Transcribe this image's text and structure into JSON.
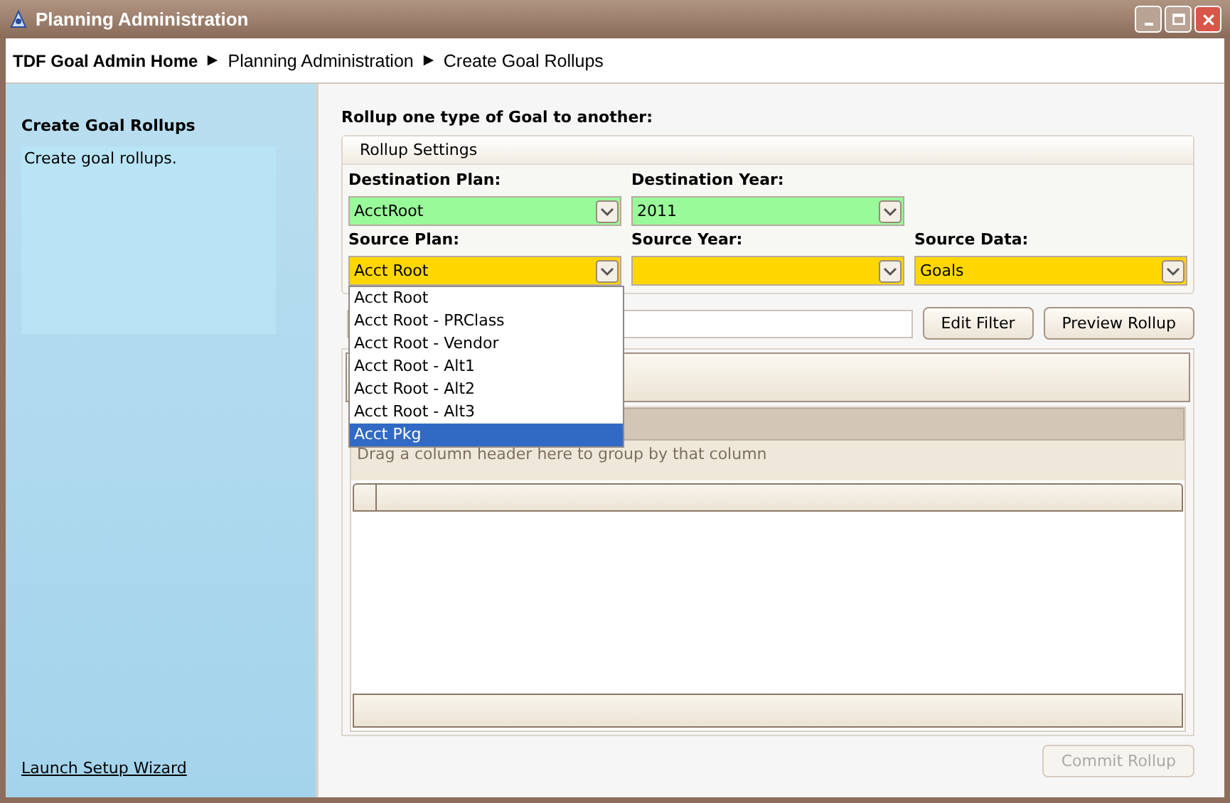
{
  "window": {
    "title": "Planning Administration",
    "controls": [
      {
        "kind": "minimize"
      },
      {
        "kind": "maximize"
      },
      {
        "kind": "close"
      }
    ]
  },
  "breadcrumb": [
    {
      "label": "TDF Goal Admin Home",
      "kind": "root"
    },
    {
      "label": "Planning Administration",
      "kind": "crumb"
    },
    {
      "label": "Create Goal Rollups",
      "kind": "crumb"
    }
  ],
  "sidebar": {
    "title": "Create Goal Rollups",
    "description": "Create goal rollups.",
    "link": "Launch Setup Wizard"
  },
  "main": {
    "heading": "Rollup one type of Goal to another:",
    "settings": {
      "title": "Rollup Settings",
      "rows": [
        [
          {
            "label": "Destination Plan:",
            "value": "AcctRoot",
            "color": "#99fa99"
          },
          {
            "label": "Destination Year:",
            "value": "2011",
            "color": "#99fa99"
          }
        ],
        [
          {
            "label": "Source Plan:",
            "value": "Acct Root",
            "color": "#ffd700",
            "expanded": true
          },
          {
            "label": "Source Year:",
            "color": "#ffd700",
            "expanded": false
          },
          {
            "label": "Source Data:",
            "value": "Goals",
            "color": "#ffd700",
            "expanded": false
          }
        ]
      ],
      "options": [
        {
          "label": "Acct Root",
          "selected": false
        },
        {
          "label": "Acct Root - PRClass",
          "selected": false
        },
        {
          "label": "Acct Root - Vendor",
          "selected": false
        },
        {
          "label": "Acct Root - Alt1",
          "selected": false
        },
        {
          "label": "Acct Root - Alt2",
          "selected": false
        },
        {
          "label": "Acct Root - Alt3",
          "selected": false
        },
        {
          "label": "Acct Pkg",
          "selected": true
        }
      ]
    },
    "filter_buttons": [
      {
        "label": "Edit Filter",
        "disabled": false
      },
      {
        "label": "Preview Rollup",
        "disabled": false
      }
    ],
    "grid": {
      "group_hint": "Drag a column header here to group by that column"
    },
    "commit": {
      "label": "Commit Rollup",
      "disabled": true
    }
  }
}
